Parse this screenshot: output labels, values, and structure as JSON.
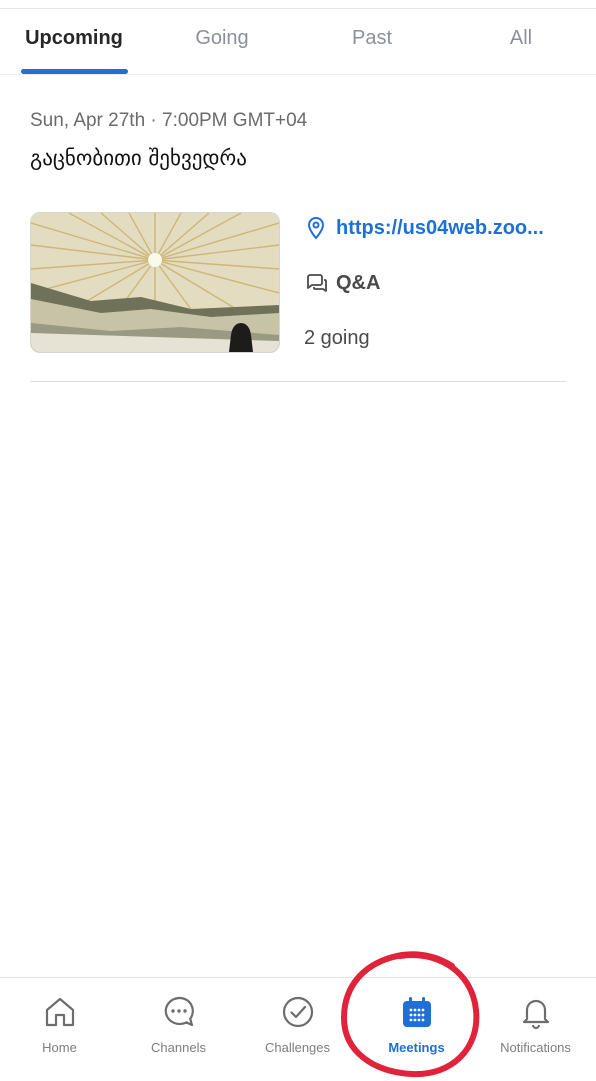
{
  "tabs": [
    {
      "label": "Upcoming",
      "active": true
    },
    {
      "label": "Going",
      "active": false
    },
    {
      "label": "Past",
      "active": false
    },
    {
      "label": "All",
      "active": false
    }
  ],
  "event": {
    "date": "Sun, Apr 27th · 7:00PM GMT+04",
    "title": "გაცნობითი შეხვედრა",
    "link": "https://us04web.zoo...",
    "discussion": "Q&A",
    "attendance": "2 going"
  },
  "bottom_nav": [
    {
      "label": "Home",
      "icon": "home-icon",
      "active": false
    },
    {
      "label": "Channels",
      "icon": "chat-icon",
      "active": false
    },
    {
      "label": "Challenges",
      "icon": "check-circle-icon",
      "active": false
    },
    {
      "label": "Meetings",
      "icon": "calendar-icon",
      "active": true
    },
    {
      "label": "Notifications",
      "icon": "bell-icon",
      "active": false
    }
  ],
  "colors": {
    "accent": "#1e6fd6",
    "annotation": "#e0233a"
  }
}
